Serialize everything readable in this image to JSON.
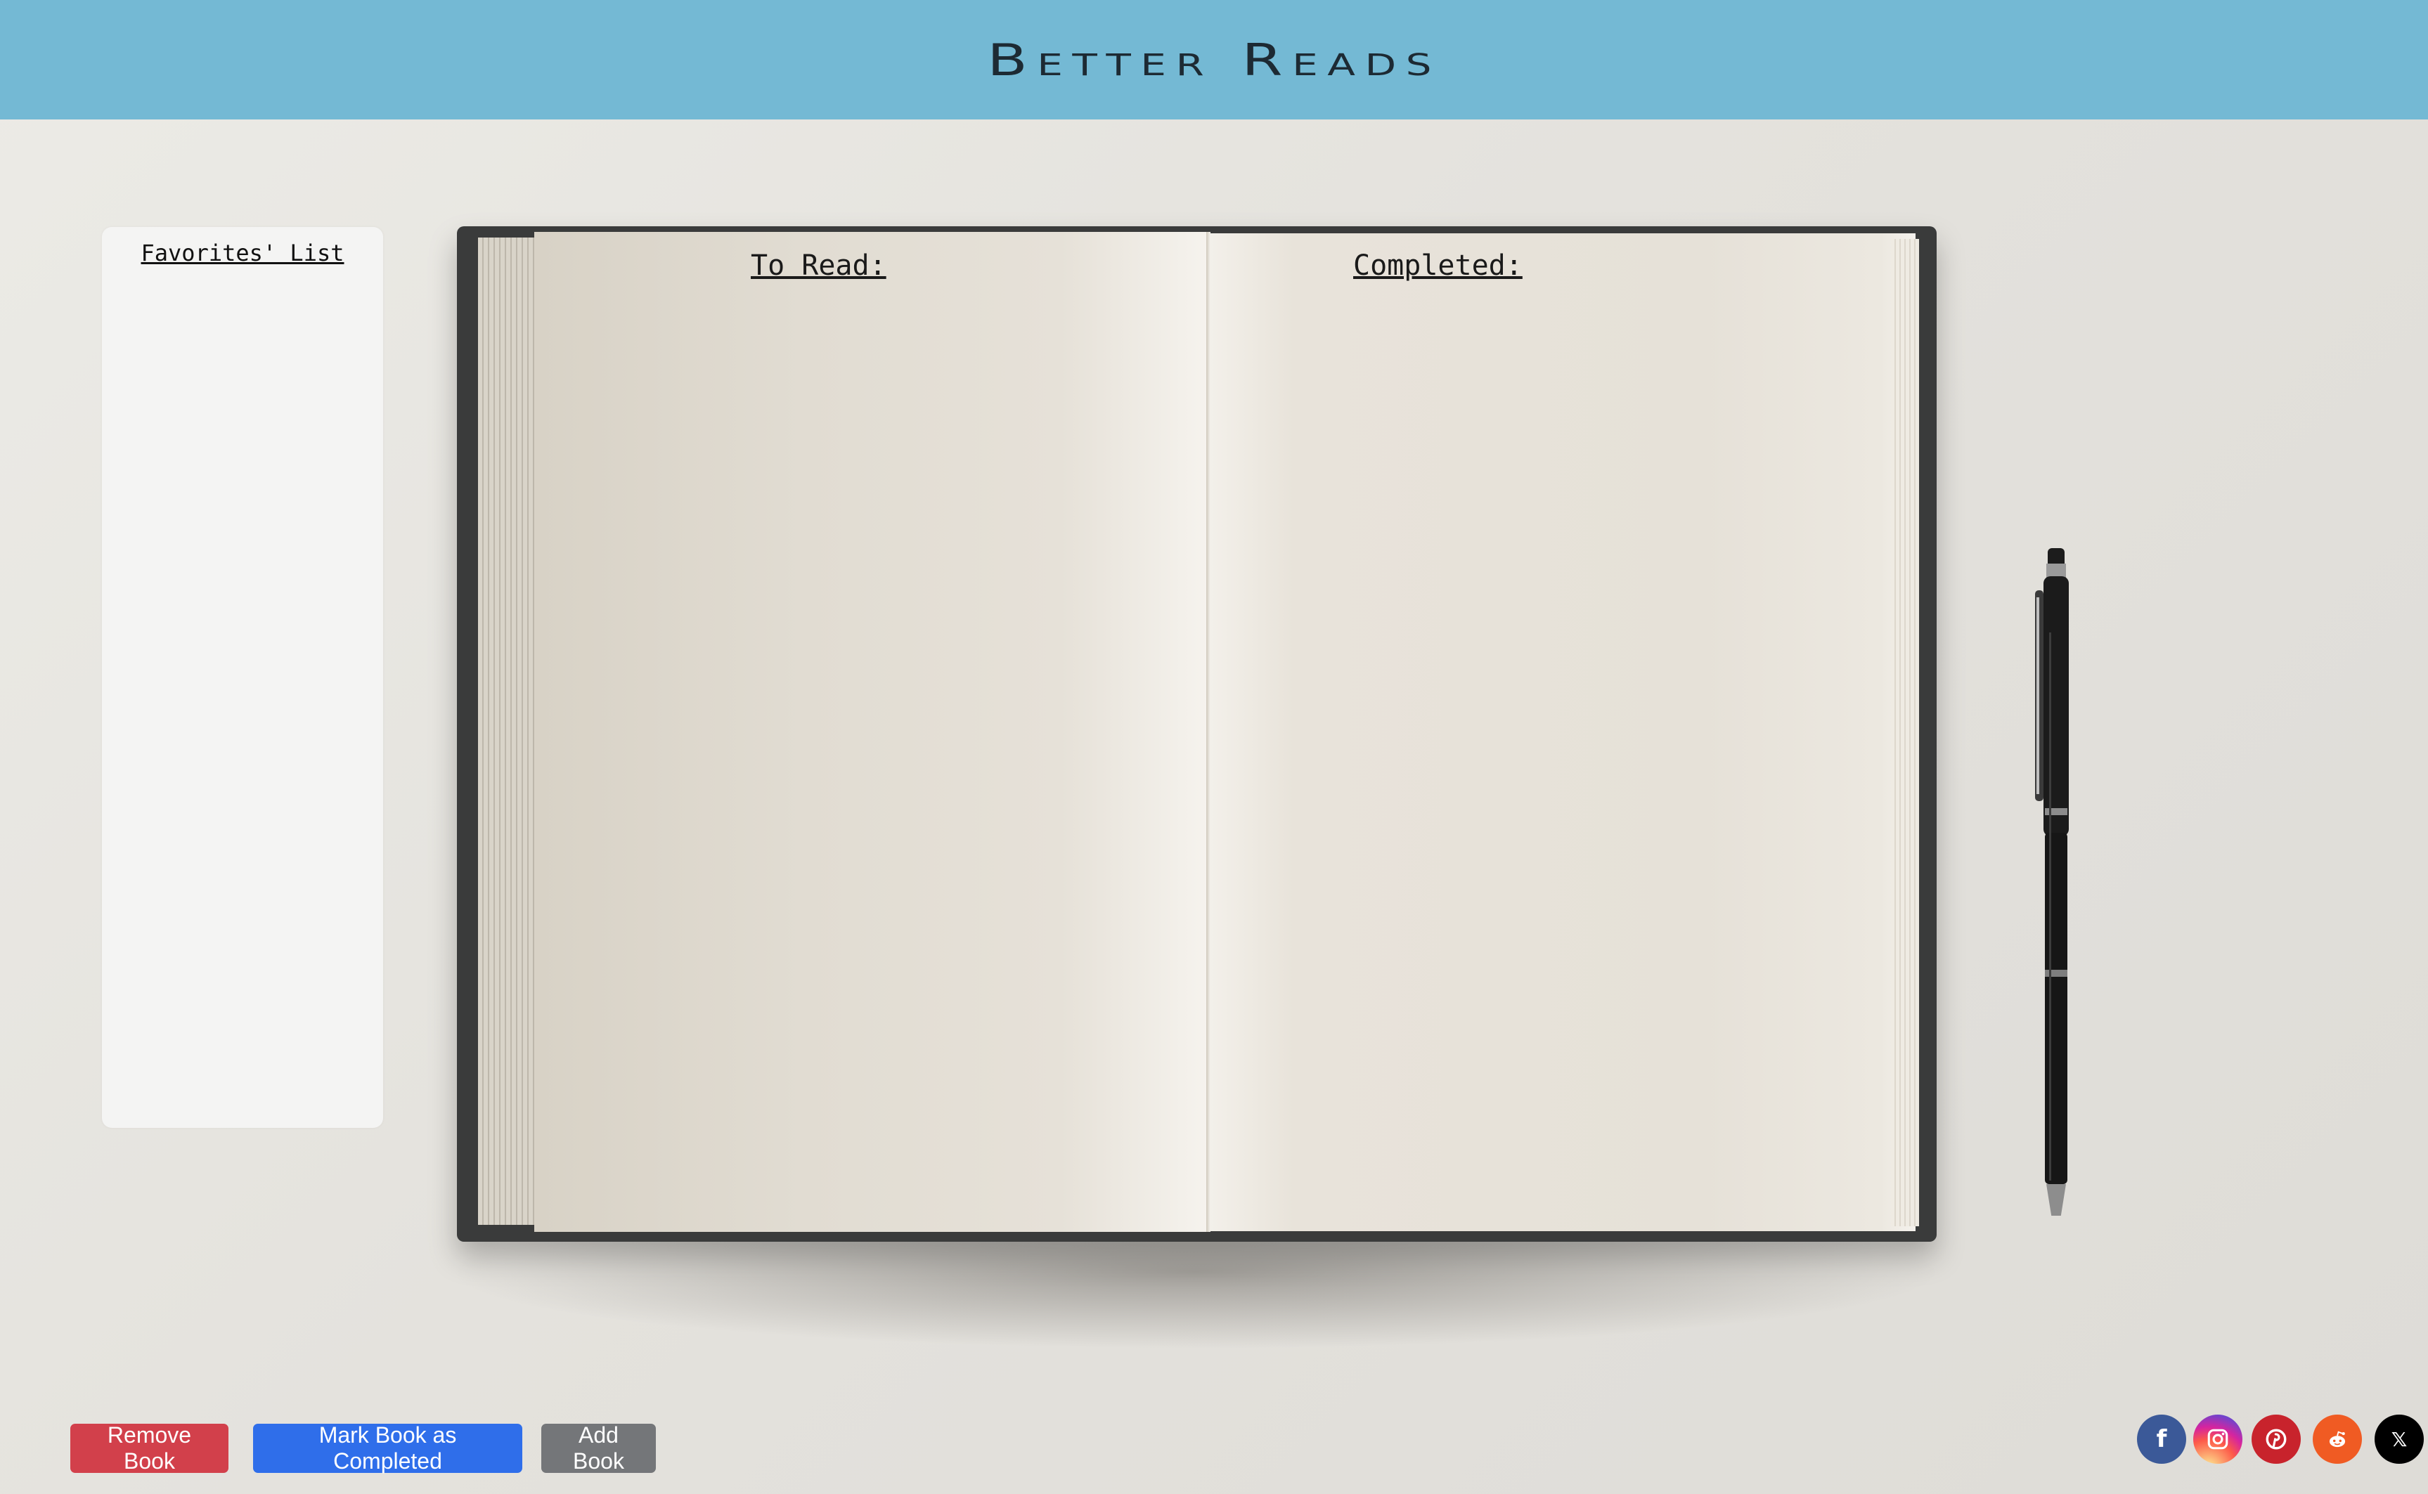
{
  "header": {
    "title": "Better Reads"
  },
  "favorites": {
    "title": "Favorites' List"
  },
  "notebook": {
    "to_read_heading": "To Read:",
    "completed_heading": "Completed:"
  },
  "actions": {
    "remove_label": "Remove Book",
    "complete_label": "Mark Book as Completed",
    "add_label": "Add Book"
  },
  "social": {
    "x_glyph": "𝕏",
    "icons": [
      "facebook-icon",
      "instagram-icon",
      "pinterest-icon",
      "reddit-icon",
      "x-icon"
    ]
  },
  "colors": {
    "header_bg": "#74b9d4",
    "remove": "#d2404b",
    "complete": "#2f6eea",
    "add": "#747679"
  }
}
